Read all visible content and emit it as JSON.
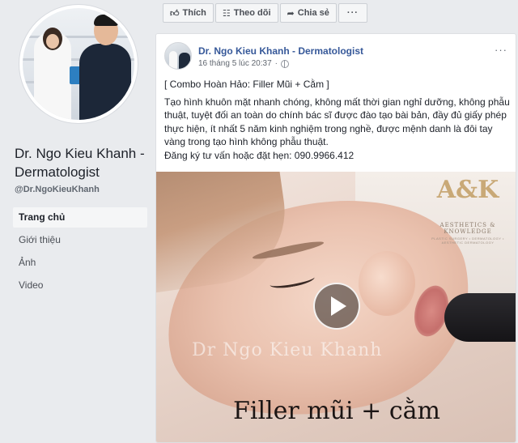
{
  "page": {
    "name": "Dr. Ngo Kieu Khanh - Dermatologist",
    "handle": "@Dr.NgoKieuKhanh"
  },
  "nav": {
    "items": [
      {
        "label": "Trang chủ",
        "active": true
      },
      {
        "label": "Giới thiệu",
        "active": false
      },
      {
        "label": "Ảnh",
        "active": false
      },
      {
        "label": "Video",
        "active": false
      }
    ]
  },
  "actions": {
    "like_label": "Thích",
    "follow_label": "Theo dõi",
    "share_label": "Chia sẻ",
    "more_label": "···"
  },
  "post": {
    "author": "Dr. Ngo Kieu Khanh - Dermatologist",
    "timestamp": "16 tháng 5 lúc 20:37",
    "privacy_separator": "·",
    "menu": "···",
    "title": "[ Combo Hoàn Hảo: Filler Mũi + Cằm ]",
    "body": "Tạo hình khuôn mặt nhanh chóng, không mất thời gian nghỉ dưỡng, không phẫu thuật, tuyệt đối an toàn do chính bác sĩ được đào tạo bài bản, đầy đủ giấy phép thực hiện, ít nhất 5 năm kinh nghiệm trong nghề, được mệnh danh là đôi tay vàng trong tạo hình không phẫu thuật.",
    "contact": "Đăng ký tư vấn hoặc đặt hẹn: 090.9966.412"
  },
  "video": {
    "brand_mark": "A&K",
    "brand_line1": "AESTHETICS & KNOWLEDGE",
    "brand_line2": "PLASTIC SURGERY • DERMATOLOGY • AESTHETIC DERMATOLOGY",
    "watermark": "Dr Ngo Kieu Khanh",
    "caption": "Filler mũi + cằm"
  },
  "colors": {
    "link_blue": "#365899",
    "background": "#e9ebee",
    "card": "#ffffff"
  },
  "icons": {
    "like": "thumbs-up-icon",
    "follow": "rss-icon",
    "share": "share-arrow-icon",
    "privacy": "globe-icon",
    "play": "play-icon"
  }
}
